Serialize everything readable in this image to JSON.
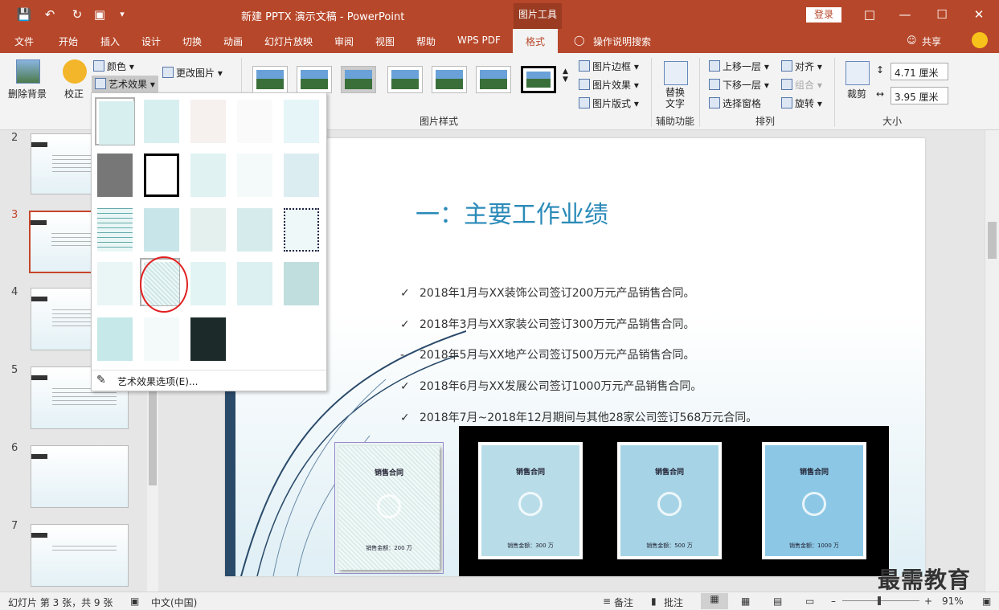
{
  "window": {
    "title": "新建 PPTX 演示文稿 - PowerPoint",
    "tool_context": "图片工具",
    "login": "登录"
  },
  "tabs": [
    "文件",
    "开始",
    "插入",
    "设计",
    "切换",
    "动画",
    "幻灯片放映",
    "审阅",
    "视图",
    "帮助",
    "WPS PDF",
    "格式"
  ],
  "active_tab": "格式",
  "tell_me": "操作说明搜索",
  "share": "共享",
  "ribbon": {
    "remove_bg": "删除背景",
    "correct": "校正",
    "color": "颜色",
    "art_effects": "艺术效果",
    "change_picture": "更改图片",
    "picture_border": "图片边框",
    "picture_effects": "图片效果",
    "picture_layout": "图片版式",
    "group_picture_styles": "图片样式",
    "alt_text": "替换文字",
    "group_accessibility": "辅助功能",
    "bring_forward": "上移一层",
    "send_backward": "下移一层",
    "selection_pane": "选择窗格",
    "align": "对齐",
    "group_objects": "组合",
    "rotate": "旋转",
    "group_arrange": "排列",
    "crop": "裁剪",
    "height": "4.71 厘米",
    "width": "3.95 厘米",
    "group_size": "大小"
  },
  "art_menu": {
    "options": "艺术效果选项(E)..."
  },
  "slides": {
    "numbers": [
      "2",
      "3",
      "4",
      "5",
      "6",
      "7"
    ],
    "active": "3"
  },
  "slide": {
    "heading": "一：主要工作业绩",
    "bullets": [
      {
        "mark": "✓",
        "text": "2018年1月与XX装饰公司签订200万元产品销售合同。"
      },
      {
        "mark": "✓",
        "text": "2018年3月与XX家装公司签订300万元产品销售合同。"
      },
      {
        "mark": "-",
        "text": "2018年5月与XX地产公司签订500万元产品销售合同。"
      },
      {
        "mark": "✓",
        "text": "2018年6月与XX发展公司签订1000万元产品销售合同。"
      },
      {
        "mark": "✓",
        "text": "2018年7月~2018年12月期间与其他28家公司签订568万元合同。"
      }
    ],
    "contracts": [
      {
        "title": "销售合同",
        "amount": "销售金额：200 万"
      },
      {
        "title": "销售合同",
        "amount": "销售金额：300 万"
      },
      {
        "title": "销售合同",
        "amount": "销售金额：500 万"
      },
      {
        "title": "销售合同",
        "amount": "销售金额：1000 万"
      }
    ]
  },
  "status": {
    "slide_info": "幻灯片 第 3 张，共 9 张",
    "language": "中文(中国)",
    "notes": "备注",
    "comments": "批注",
    "zoom": "91%"
  },
  "watermark": "最需教育",
  "colors": {
    "accent": "#b7472a",
    "heading": "#2a8ab8",
    "highlight": "#e02020"
  }
}
